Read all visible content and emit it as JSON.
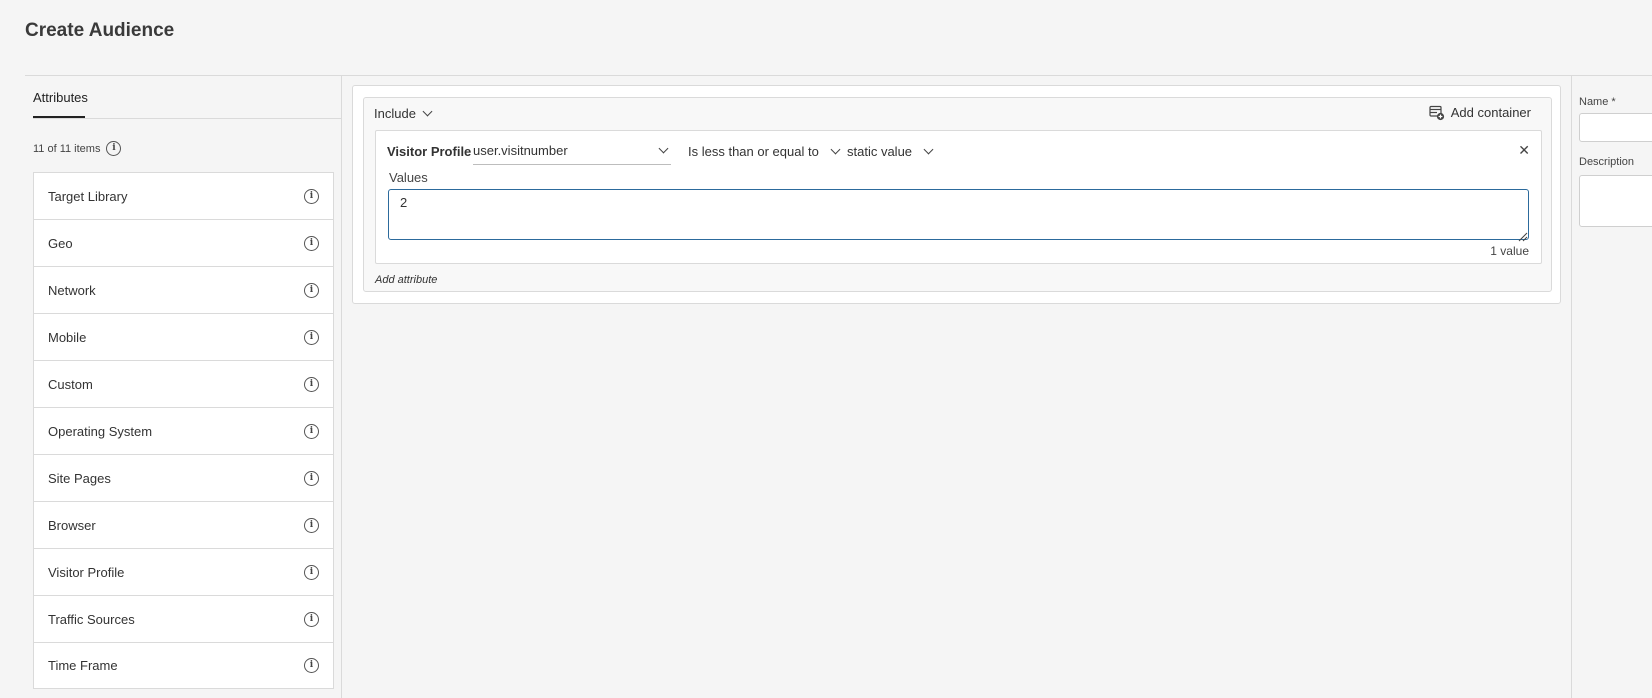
{
  "header": {
    "title": "Create Audience"
  },
  "left_panel": {
    "tab_label": "Attributes",
    "item_count": "11 of 11 items",
    "items": [
      {
        "label": "Target Library"
      },
      {
        "label": "Geo"
      },
      {
        "label": "Network"
      },
      {
        "label": "Mobile"
      },
      {
        "label": "Custom"
      },
      {
        "label": "Operating System"
      },
      {
        "label": "Site Pages"
      },
      {
        "label": "Browser"
      },
      {
        "label": "Visitor Profile"
      },
      {
        "label": "Traffic Sources"
      },
      {
        "label": "Time Frame"
      }
    ]
  },
  "builder": {
    "include_label": "Include",
    "add_container_label": "Add container",
    "rule": {
      "category": "Visitor Profile",
      "attribute": "user.visitnumber",
      "operator": "Is less than or equal to",
      "value_type": "static value",
      "values_label": "Values",
      "value": "2",
      "value_count": "1 value"
    },
    "add_attribute_label": "Add attribute"
  },
  "properties": {
    "name_label": "Name *",
    "description_label": "Description"
  },
  "colors": {
    "focus_border": "#2c6a9c",
    "background": "#f5f5f5"
  }
}
